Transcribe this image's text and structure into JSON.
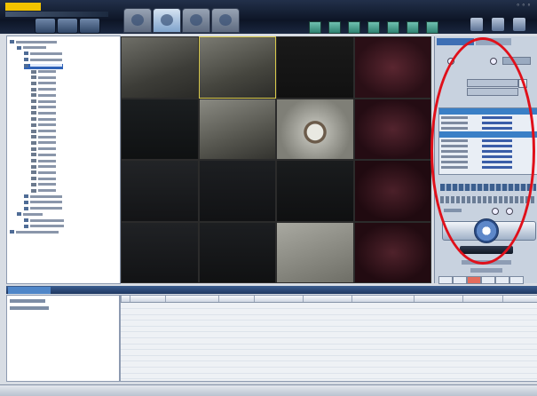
{
  "app": {
    "brand": "",
    "window_controls": "◦◦◦"
  },
  "top_tabs": [
    {
      "name": "tab-preview",
      "active": false
    },
    {
      "name": "tab-live-view",
      "active": true
    },
    {
      "name": "tab-playback",
      "active": false
    },
    {
      "name": "tab-config",
      "active": false
    }
  ],
  "left_toolbar": [
    "add-icon",
    "edit-icon",
    "terminal-icon"
  ],
  "right_toolbar_icons": [
    "layout-1-icon",
    "layout-4-icon",
    "layout-9-icon",
    "layout-16-icon",
    "layout-25-icon",
    "layout-36-icon",
    "fullscreen-icon",
    "lock-icon",
    "help-icon",
    "user-icon"
  ],
  "colors": {
    "accent": "#3a7fc6",
    "annotation_red": "#e0101a",
    "tile_bg": "#0d0d0f"
  },
  "device_tree": {
    "label": "device-tree"
  },
  "video_wall": {
    "cols": 4,
    "rows": 4,
    "tile_labels": []
  },
  "control_panel": {
    "tab1": "",
    "tab2": ""
  },
  "log_panel": {
    "tab_label": ""
  },
  "statusbar": {
    "text": "",
    "right": ""
  }
}
